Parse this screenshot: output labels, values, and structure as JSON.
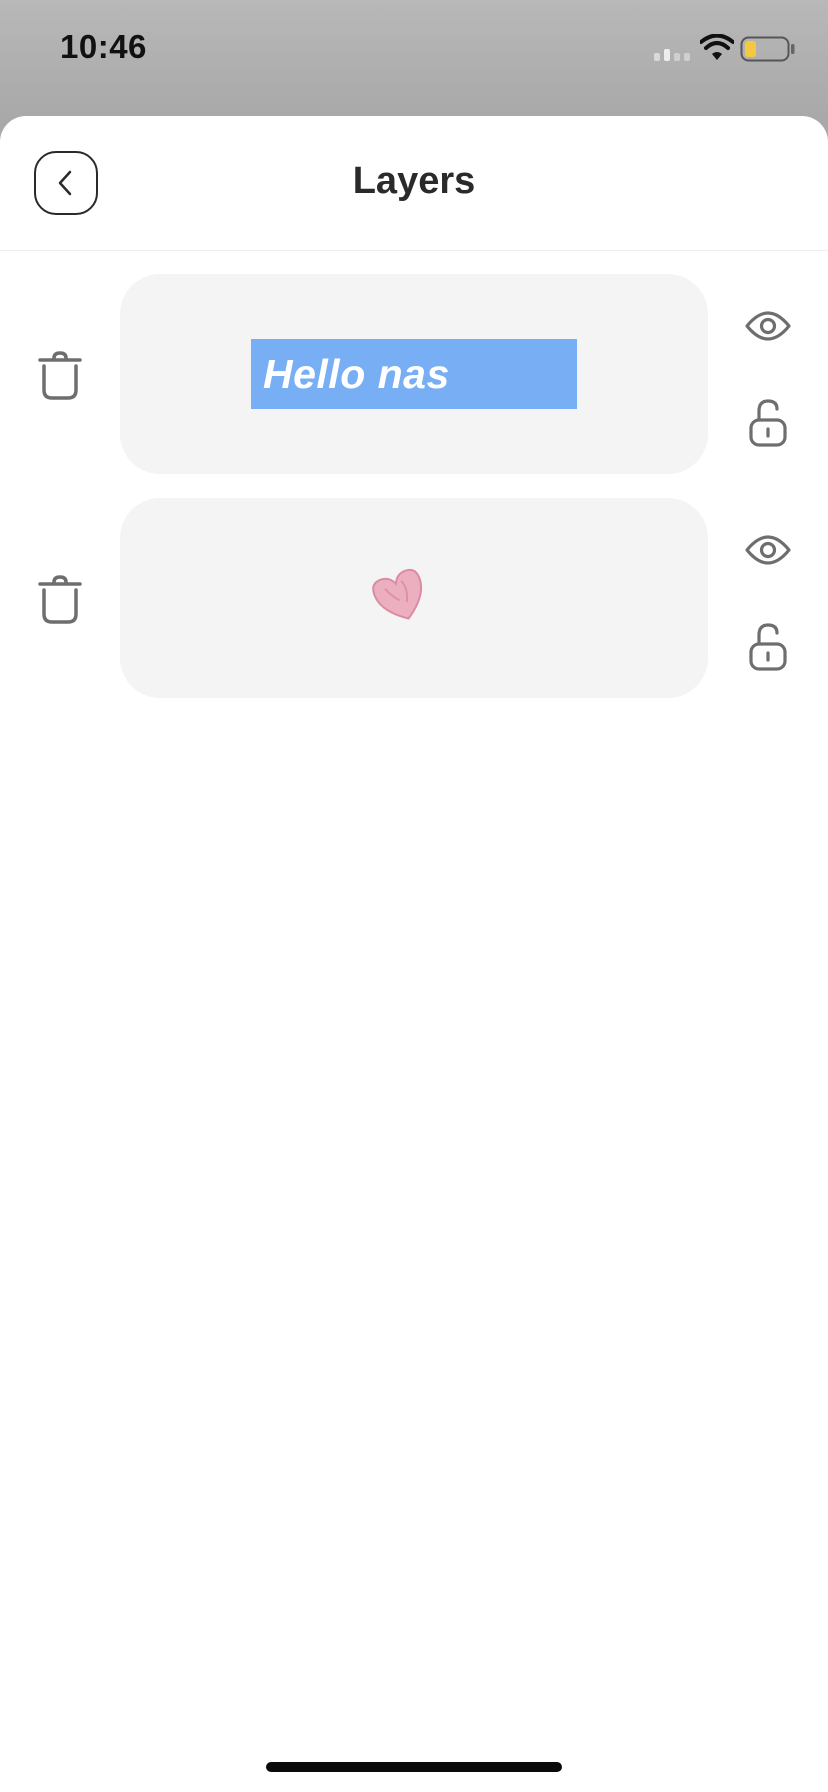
{
  "status_bar": {
    "time": "10:46",
    "icons": [
      "cellular-signal-icon",
      "wifi-icon",
      "battery-low-icon"
    ],
    "battery_color": "#f5c842"
  },
  "header": {
    "title": "Layers",
    "back_icon": "chevron-left-icon"
  },
  "layers": [
    {
      "type": "text",
      "preview_text": "Hello nas",
      "preview_bg_color": "#78aef3",
      "preview_text_color": "#ffffff",
      "visible": true,
      "locked": false,
      "delete_icon": "trash-icon",
      "visibility_icon": "eye-icon",
      "lock_icon": "unlock-icon"
    },
    {
      "type": "sticker",
      "sticker_icon": "pink-heart-icon",
      "sticker_color": "#e78aa6",
      "visible": true,
      "locked": false,
      "delete_icon": "trash-icon",
      "visibility_icon": "eye-icon",
      "lock_icon": "unlock-icon"
    }
  ],
  "colors": {
    "sheet_bg": "#ffffff",
    "card_bg": "#f4f4f4",
    "icon_gray": "#6e6e6e",
    "title_color": "#2a2a2a"
  }
}
